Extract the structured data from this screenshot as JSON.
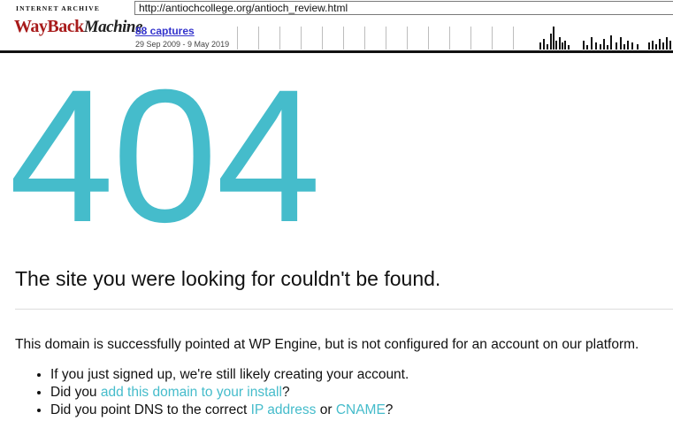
{
  "wayback": {
    "logo_top": "INTERNET ARCHIVE",
    "logo_way": "WayBack",
    "logo_machine": "Machine",
    "url": "http://antiochcollege.org/antioch_review.html",
    "captures_label": "88 captures",
    "date_range": "29 Sep 2009 - 9 May 2019"
  },
  "page": {
    "error_code": "404",
    "headline": "The site you were looking for couldn't be found.",
    "intro": "This domain is successfully pointed at WP Engine, but is not configured for an account on our platform.",
    "bullets": {
      "b1": "If you just signed up, we're still likely creating your account.",
      "b2_pre": "Did you ",
      "b2_link": "add this domain to your install",
      "b2_post": "?",
      "b3_pre": "Did you point DNS to the correct ",
      "b3_link1": "IP address",
      "b3_mid": " or ",
      "b3_link2": "CNAME",
      "b3_post": "?"
    }
  },
  "colors": {
    "accent": "#45bccb",
    "wayback_red": "#a81b1b",
    "captures_link": "#3333cc"
  }
}
